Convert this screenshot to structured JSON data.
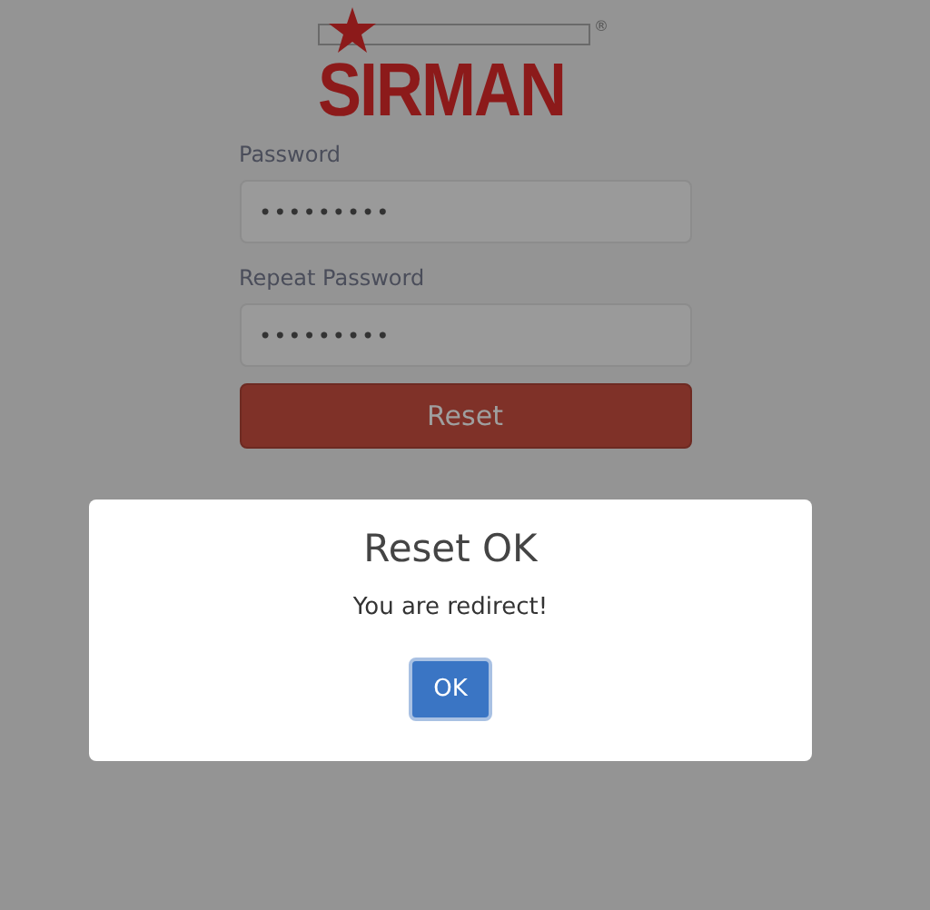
{
  "logo": {
    "brand": "SIRMAN",
    "registered_mark": "®"
  },
  "form": {
    "fields": [
      {
        "label": "Password",
        "value": "•••••••••"
      },
      {
        "label": "Repeat Password",
        "value": "•••••••••"
      }
    ],
    "submit": "Reset"
  },
  "dialog": {
    "title": "Reset OK",
    "message": "You are redirect!",
    "button": "OK"
  }
}
